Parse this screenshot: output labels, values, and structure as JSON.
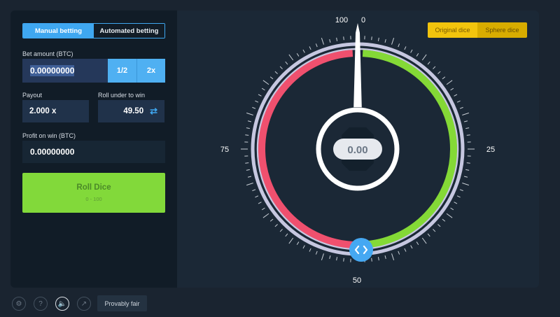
{
  "tabs": {
    "manual": "Manual betting",
    "auto": "Automated betting"
  },
  "bet": {
    "label": "Bet amount (BTC)",
    "value": "0.00000000",
    "half": "1/2",
    "double": "2x"
  },
  "payout": {
    "label": "Payout",
    "value": "2.000 x"
  },
  "roll_under": {
    "label": "Roll under to win",
    "value": "49.50",
    "swap_icon": "swap-arrows-icon"
  },
  "profit": {
    "label": "Profit on win (BTC)",
    "value": "0.00000000"
  },
  "roll_button": {
    "label": "Roll Dice",
    "sub": "0 - 100"
  },
  "dice_mode": {
    "original": "Original dice",
    "sphere": "Sphere dice"
  },
  "dial": {
    "top_left": "100",
    "top_right": "0",
    "right": "25",
    "bottom": "50",
    "left": "75",
    "result": "0.00",
    "win_fraction": 0.495
  },
  "colors": {
    "lose": "#f0506e",
    "win": "#84d936",
    "accent": "#3fa7f0"
  },
  "footer": {
    "settings_icon": "settings-icon",
    "help_icon": "help-icon",
    "sound_icon": "sound-icon",
    "stats_icon": "stats-icon",
    "fair_label": "Provably fair"
  }
}
